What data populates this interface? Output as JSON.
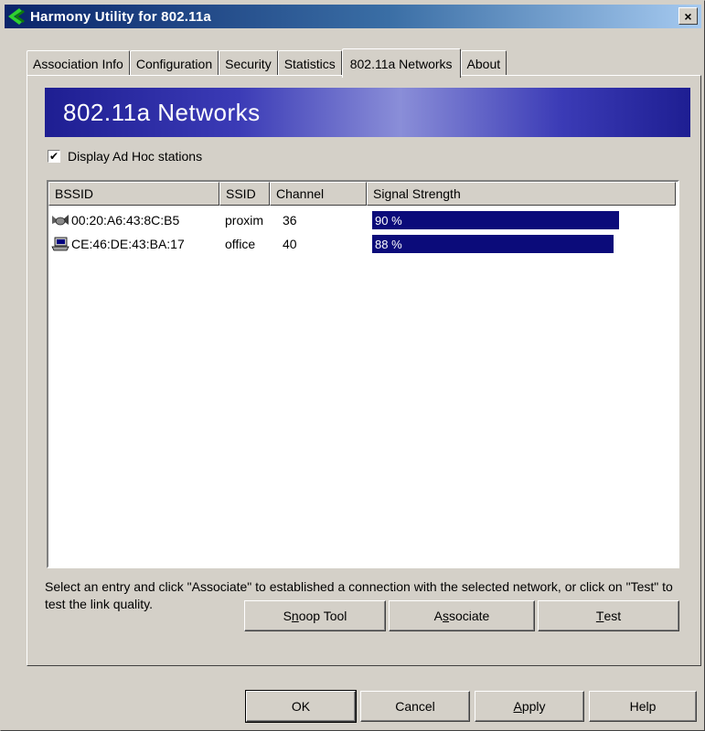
{
  "window": {
    "title": "Harmony Utility for 802.11a",
    "close_label": "×"
  },
  "tabs": [
    {
      "label": "Association Info"
    },
    {
      "label": "Configuration"
    },
    {
      "label": "Security"
    },
    {
      "label": "Statistics"
    },
    {
      "label": "802.11a Networks",
      "active": true
    },
    {
      "label": "About"
    }
  ],
  "panel": {
    "banner_title": "802.11a Networks",
    "adhoc_checkbox": {
      "label": "Display Ad Hoc stations",
      "checked": true,
      "mark": "✔"
    }
  },
  "networks_table": {
    "columns": [
      "BSSID",
      "SSID",
      "Channel",
      "Signal Strength"
    ],
    "rows": [
      {
        "icon": "access-point-icon",
        "bssid": "00:20:A6:43:8C:B5",
        "ssid": "proxim",
        "channel": "36",
        "signal": 90,
        "signal_label": "90 %"
      },
      {
        "icon": "computer-icon",
        "bssid": "CE:46:DE:43:BA:17",
        "ssid": "office",
        "channel": "40",
        "signal": 88,
        "signal_label": "88 %"
      }
    ]
  },
  "help_text": "Select an entry and click \"Associate\" to established a connection with the selected network, or click on \"Test\" to test the link quality.",
  "panel_buttons": {
    "snoop_pre": "S",
    "snoop_u": "n",
    "snoop_post": "oop Tool",
    "associate_pre": "A",
    "associate_u": "s",
    "associate_post": "sociate",
    "test_u": "T",
    "test_post": "est"
  },
  "dialog_buttons": {
    "ok": "OK",
    "cancel": "Cancel",
    "apply_u": "A",
    "apply_post": "pply",
    "help": "Help"
  },
  "colors": {
    "signal_bar": "#0b0b7a",
    "banner": "#1e1e92"
  }
}
